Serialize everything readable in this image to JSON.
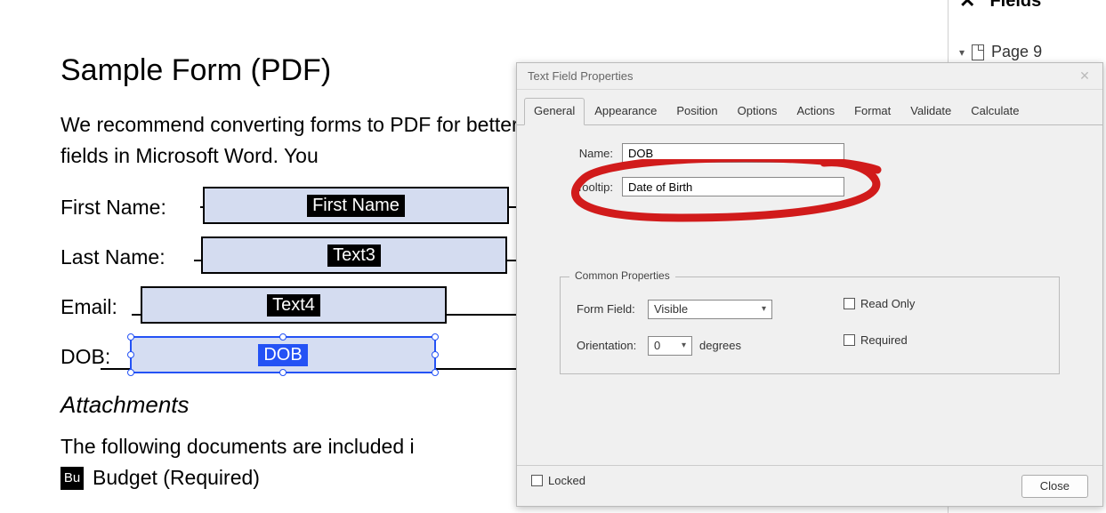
{
  "doc": {
    "title": "Sample Form (PDF)",
    "intro": "We recommend converting forms to PDF for better accessibility. Do not use the interactive form fields in Microsoft Word. You",
    "labels": {
      "first": "First Name:",
      "last": "Last Name:",
      "email": "Email:",
      "dob": "DOB:"
    },
    "fieldTags": {
      "first": "First Name",
      "last": "Text3",
      "email": "Text4",
      "dob": "DOB"
    },
    "attachmentsHeading": "Attachments",
    "attachmentsIntro": "The following documents are included i",
    "buIcon": "Bu",
    "budget": "Budget (Required)"
  },
  "sidepanel": {
    "title": "Fields",
    "page": "Page 9"
  },
  "dialog": {
    "title": "Text Field Properties",
    "tabs": [
      "General",
      "Appearance",
      "Position",
      "Options",
      "Actions",
      "Format",
      "Validate",
      "Calculate"
    ],
    "nameLabel": "Name:",
    "nameValue": "DOB",
    "tooltipLabel": "Tooltip:",
    "tooltipValue": "Date of Birth",
    "commonLegend": "Common Properties",
    "formFieldLabel": "Form Field:",
    "formFieldValue": "Visible",
    "orientationLabel": "Orientation:",
    "orientationValue": "0",
    "degrees": "degrees",
    "readOnly": "Read Only",
    "required": "Required",
    "locked": "Locked",
    "close": "Close"
  }
}
